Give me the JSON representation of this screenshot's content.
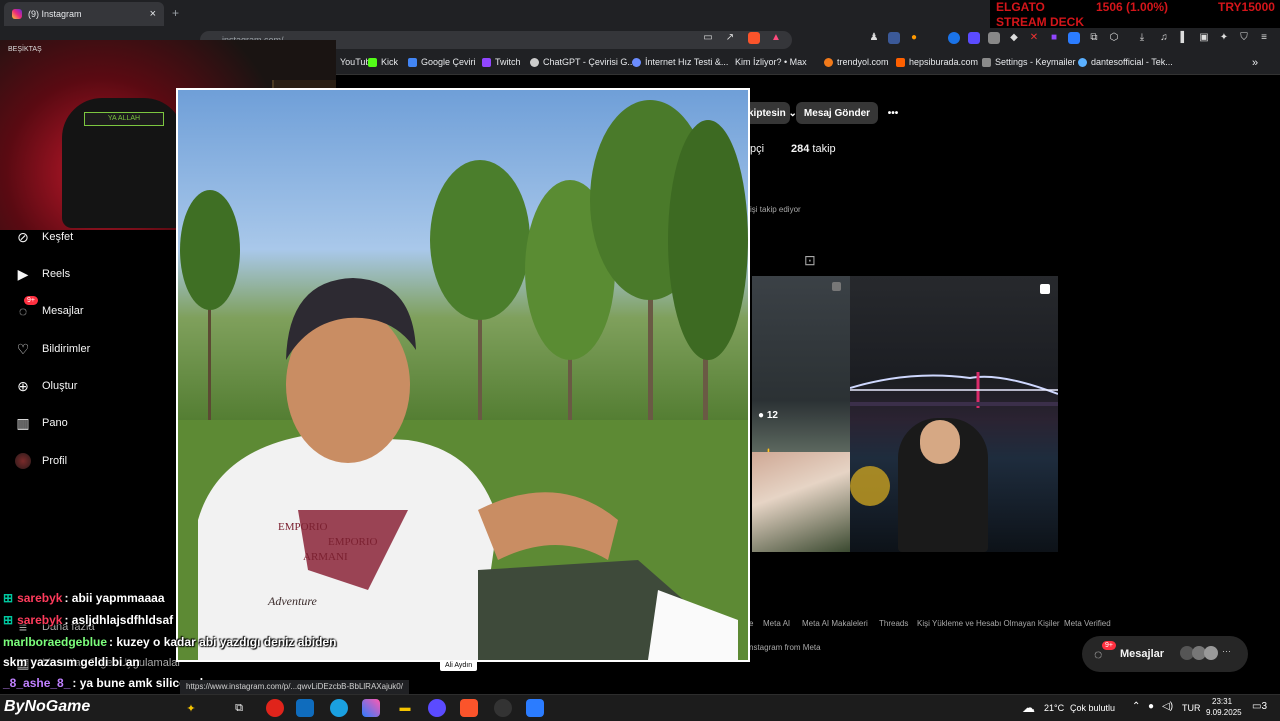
{
  "browser": {
    "tab_title": "(9) Instagram",
    "tab_close": "×",
    "new_tab": "+",
    "url_partial": "instagram.com/"
  },
  "ticker": {
    "line1_a": "ELGATO",
    "line1_b": "1506 (1.00%)",
    "line1_c": "TRY15000",
    "line2": "STREAM DECK"
  },
  "bookmarks": [
    {
      "label": "YouTube",
      "color": "#ff0000"
    },
    {
      "label": "Kick",
      "color": "#53fc18"
    },
    {
      "label": "Google Çeviri",
      "color": "#4285f4"
    },
    {
      "label": "Twitch",
      "color": "#9146ff"
    },
    {
      "label": "ChatGPT - Çevirisi G...",
      "color": "#cccccc"
    },
    {
      "label": "İnternet Hız Testi &...",
      "color": "#6b8cff"
    },
    {
      "label": "Kim İzliyor? • Max",
      "color": "#2b2bff"
    },
    {
      "label": "trendyol.com",
      "color": "#f27a1a"
    },
    {
      "label": "hepsiburada.com",
      "color": "#ff6000"
    },
    {
      "label": "Settings - Keymailer",
      "color": "#8a8a8a"
    },
    {
      "label": "dantesofficial - Tek...",
      "color": "#5ab0ff"
    }
  ],
  "sidebar": {
    "items": [
      {
        "label": "Keşfet",
        "icon": "compass-icon"
      },
      {
        "label": "Reels",
        "icon": "reels-icon"
      },
      {
        "label": "Mesajlar",
        "icon": "messenger-icon",
        "badge": "9+"
      },
      {
        "label": "Bildirimler",
        "icon": "heart-icon"
      },
      {
        "label": "Oluştur",
        "icon": "plus-square-icon"
      },
      {
        "label": "Pano",
        "icon": "chart-icon"
      },
      {
        "label": "Profil",
        "icon": "avatar-icon"
      }
    ],
    "more": "Daha fazla",
    "meta": "Meta'dan Diğer Uygulamalar"
  },
  "webcam": {
    "label": "BEŞİKTAŞ",
    "headband_text": "YA ALLAH"
  },
  "photo": {
    "caption": "Ali Aydın",
    "shirt_text_1": "EMPORIO",
    "shirt_text_2": "EMPORIO",
    "shirt_text_3": "ARMANI",
    "shirt_text_4": "Adventure"
  },
  "profile": {
    "follow_label": "Takiptesin",
    "message_label": "Mesaj Gönder",
    "more": "•••",
    "followers_suffix": "pçi",
    "following_count": "284",
    "following_label": "takip",
    "followed_by": "işi takip ediyor",
    "comments_count": "12"
  },
  "footer": {
    "links": [
      "e",
      "Meta AI",
      "Meta AI Makaleleri",
      "Threads",
      "Kişi Yükleme ve Hesabı Olmayan Kişiler",
      "Meta Verified"
    ],
    "copyright": "nstagram from Meta"
  },
  "messages_pill": {
    "label": "Mesajlar",
    "badge": "9+",
    "more": "···"
  },
  "chat": [
    {
      "user": "sarebyk",
      "user_color": "#ff3b5c",
      "text": ": abii yapmmaaaa",
      "badge": true
    },
    {
      "user": "sarebyk",
      "user_color": "#ff3b5c",
      "text": ": asljdhlajsdfhldsaf",
      "badge": true
    },
    {
      "user": "marlboraedgeblue",
      "user_color": "#7cff7c",
      "text": ": kuzey o kadar abi yazdıgı deniz abiden",
      "badge": false
    },
    {
      "user": "",
      "user_color": "#ffffff",
      "text": "skm yazasım geldi bi an",
      "badge": false
    },
    {
      "user": "_8_ashe_8_",
      "user_color": "#c080ff",
      "text": ": ya bune amk silicem bunu",
      "badge": false
    }
  ],
  "status_url": "https://www.instagram.com/p/...qwvLiDEzcbB-BbLlRAXajuk0/",
  "taskbar": {
    "brand": "ByNoGame",
    "weather_temp": "21°C",
    "weather_desc": "Çok bulutlu",
    "lang": "TUR",
    "time": "23:31",
    "date": "9.09.2025",
    "notif_count": "3"
  }
}
